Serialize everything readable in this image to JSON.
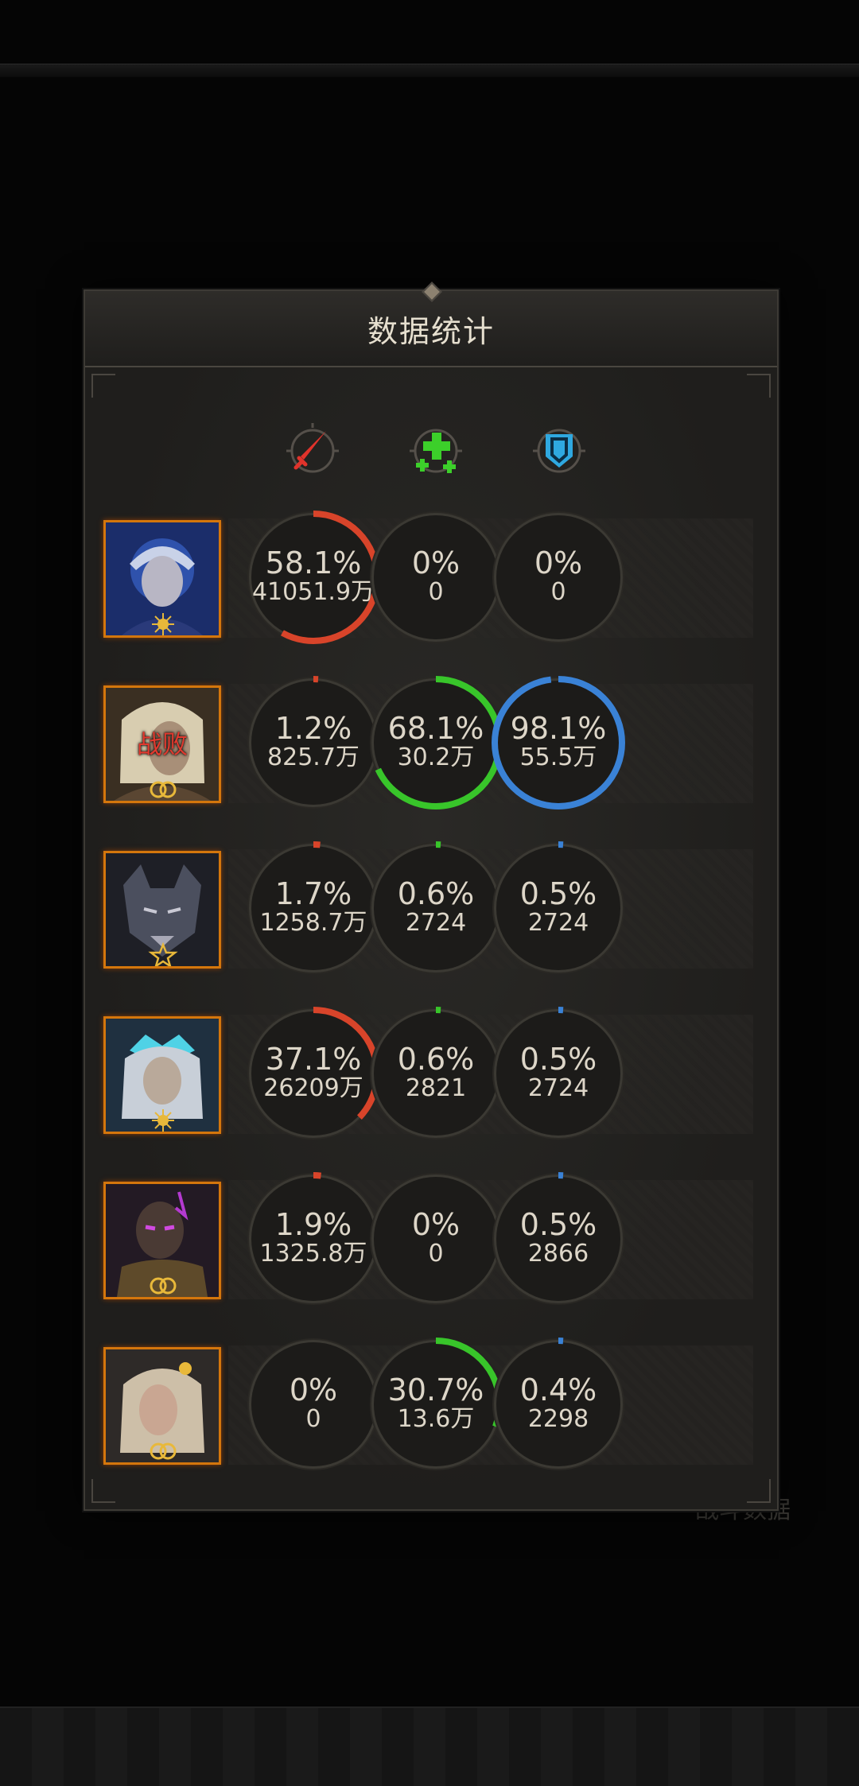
{
  "panel": {
    "title": "数据统计"
  },
  "background": {
    "ghost_label": "战斗数据"
  },
  "columns": [
    {
      "icon": "sword-damage-icon",
      "color": "#e0332b"
    },
    {
      "icon": "heal-plus-icon",
      "color": "#3ccf2a"
    },
    {
      "icon": "shield-icon",
      "color": "#2fa8e0"
    }
  ],
  "colors": {
    "damage_ring": "#d8442a",
    "heal_ring": "#38c52a",
    "shield_ring": "#3a82d6",
    "portrait_border": "#d4760c"
  },
  "heroes": [
    {
      "portrait": "blue-haired-mage-portrait",
      "badge": "sun-badge",
      "defeated": "",
      "stats": [
        {
          "pct": "58.1%",
          "value": "41051.9万",
          "fraction": 0.581
        },
        {
          "pct": "0%",
          "value": "0",
          "fraction": 0
        },
        {
          "pct": "0%",
          "value": "0",
          "fraction": 0
        }
      ]
    },
    {
      "portrait": "blonde-warrior-portrait",
      "badge": "moon-badge",
      "defeated": "战败",
      "stats": [
        {
          "pct": "1.2%",
          "value": "825.7万",
          "fraction": 0.012
        },
        {
          "pct": "68.1%",
          "value": "30.2万",
          "fraction": 0.681
        },
        {
          "pct": "98.1%",
          "value": "55.5万",
          "fraction": 0.981
        }
      ]
    },
    {
      "portrait": "werewolf-portrait",
      "badge": "star-badge",
      "defeated": "",
      "stats": [
        {
          "pct": "1.7%",
          "value": "1258.7万",
          "fraction": 0.017
        },
        {
          "pct": "0.6%",
          "value": "2724",
          "fraction": 0.006
        },
        {
          "pct": "0.5%",
          "value": "2724",
          "fraction": 0.005
        }
      ]
    },
    {
      "portrait": "ice-crowned-sage-portrait",
      "badge": "sun-badge",
      "defeated": "",
      "stats": [
        {
          "pct": "37.1%",
          "value": "26209万",
          "fraction": 0.371
        },
        {
          "pct": "0.6%",
          "value": "2821",
          "fraction": 0.006
        },
        {
          "pct": "0.5%",
          "value": "2724",
          "fraction": 0.005
        }
      ]
    },
    {
      "portrait": "dark-knight-portrait",
      "badge": "moon-badge",
      "defeated": "",
      "stats": [
        {
          "pct": "1.9%",
          "value": "1325.8万",
          "fraction": 0.019
        },
        {
          "pct": "0%",
          "value": "0",
          "fraction": 0
        },
        {
          "pct": "0.5%",
          "value": "2866",
          "fraction": 0.005
        }
      ]
    },
    {
      "portrait": "silver-haired-priestess-portrait",
      "badge": "moon-badge",
      "defeated": "",
      "stats": [
        {
          "pct": "0%",
          "value": "0",
          "fraction": 0
        },
        {
          "pct": "30.7%",
          "value": "13.6万",
          "fraction": 0.307
        },
        {
          "pct": "0.4%",
          "value": "2298",
          "fraction": 0.004
        }
      ]
    }
  ]
}
